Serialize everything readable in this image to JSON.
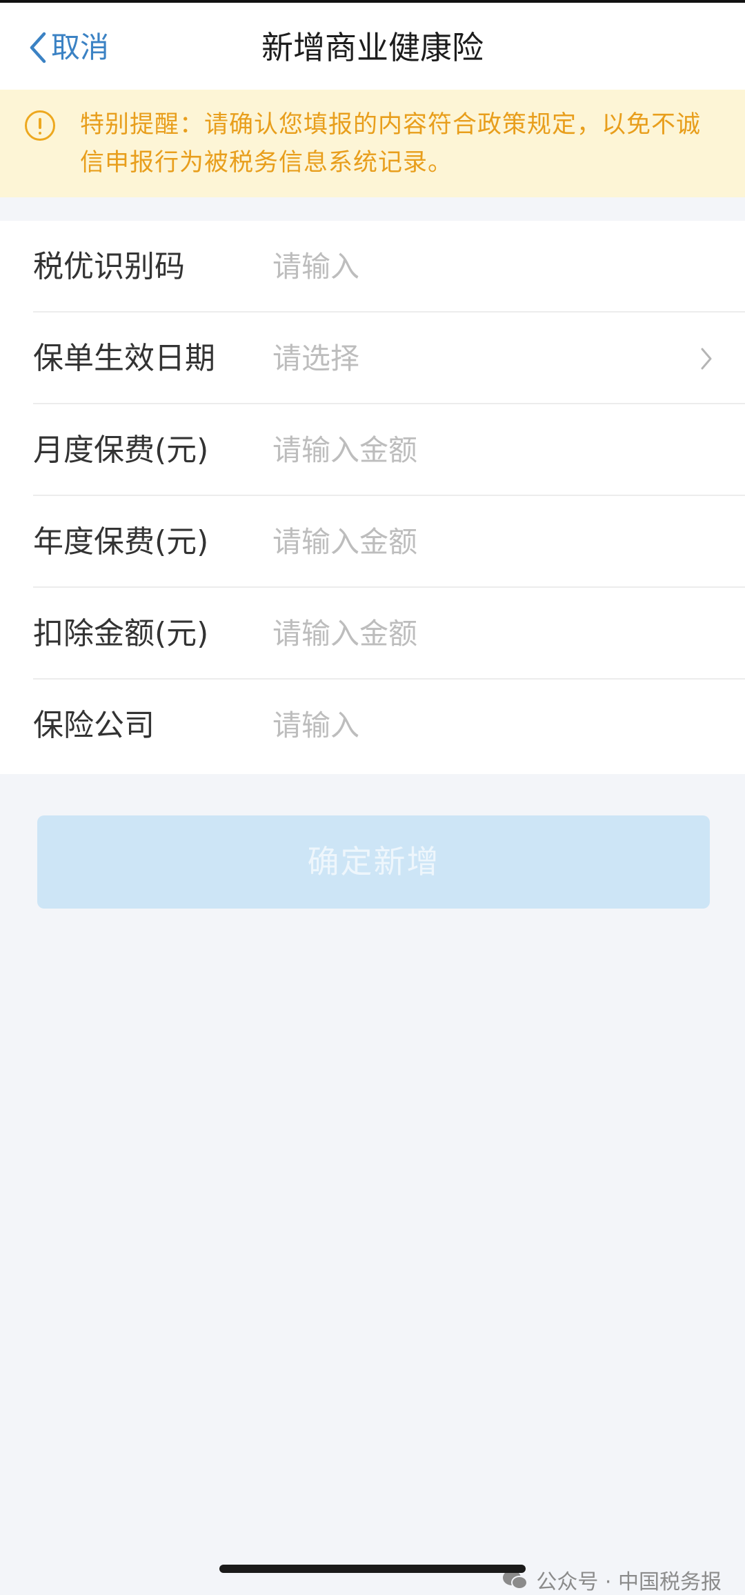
{
  "nav": {
    "back_label": "取消",
    "title": "新增商业健康险"
  },
  "notice": {
    "text": "特别提醒：请确认您填报的内容符合政策规定，以免不诚信申报行为被税务信息系统记录。"
  },
  "form": {
    "rows": [
      {
        "label": "税优识别码",
        "placeholder": "请输入"
      },
      {
        "label": "保单生效日期",
        "placeholder": "请选择"
      },
      {
        "label": "月度保费(元)",
        "placeholder": "请输入金额"
      },
      {
        "label": "年度保费(元)",
        "placeholder": "请输入金额"
      },
      {
        "label": "扣除金额(元)",
        "placeholder": "请输入金额"
      },
      {
        "label": "保险公司",
        "placeholder": "请输入"
      }
    ]
  },
  "submit": {
    "label": "确定新增"
  },
  "watermark": {
    "text": "公众号 · 中国税务报"
  },
  "colors": {
    "accent": "#3b82c4",
    "notice_bg": "#fdf5d6",
    "notice_text": "#e89e1c",
    "button_disabled": "#cde5f6"
  }
}
